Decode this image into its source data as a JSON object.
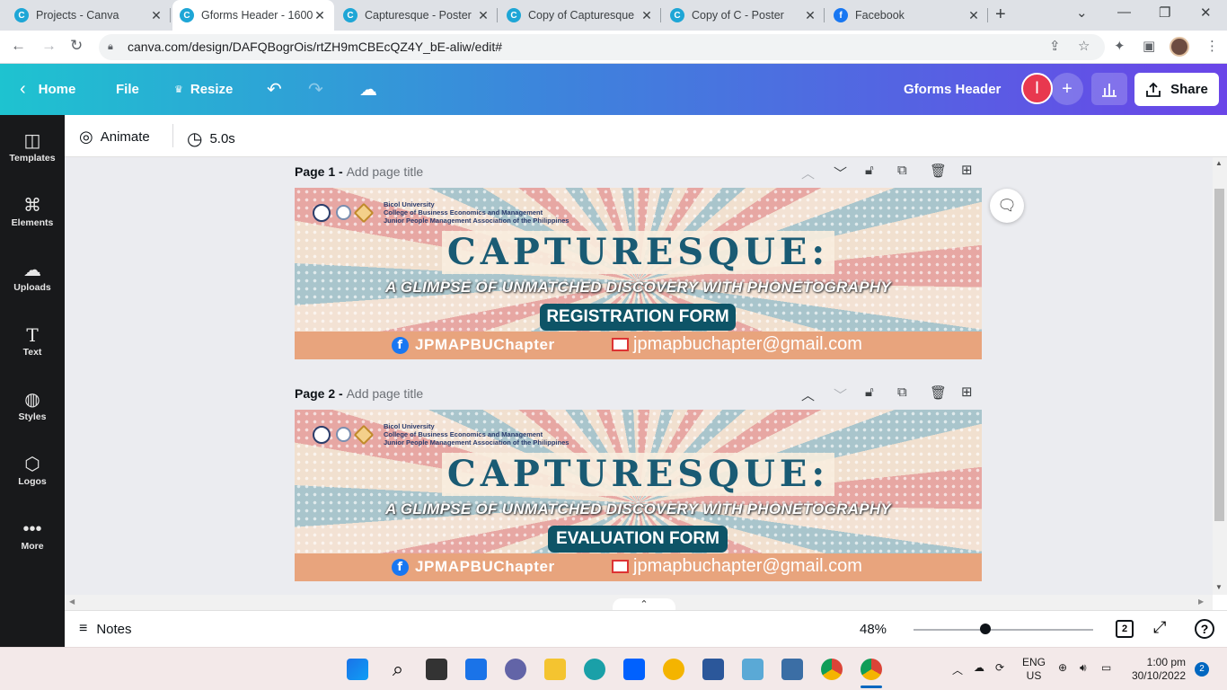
{
  "browser": {
    "tabs": [
      {
        "title": "Projects - Canva",
        "icon": "canva-icon"
      },
      {
        "title": "Gforms Header - 1600",
        "icon": "canva-icon",
        "active": true
      },
      {
        "title": "Capturesque - Poster",
        "icon": "canva-icon"
      },
      {
        "title": "Copy of Capturesque",
        "icon": "canva-icon"
      },
      {
        "title": "Copy of C - Poster",
        "icon": "canva-icon"
      },
      {
        "title": "Facebook",
        "icon": "facebook-icon"
      }
    ],
    "url": "canva.com/design/DAFQBogrOis/rtZH9mCBEcQZ4Y_bE-aliw/edit#"
  },
  "header": {
    "home": "Home",
    "file": "File",
    "resize": "Resize",
    "design_name": "Gforms Header",
    "avatar_letter": "I",
    "share": "Share"
  },
  "sidebar": {
    "items": [
      {
        "label": "Templates",
        "icon": "templates-icon"
      },
      {
        "label": "Elements",
        "icon": "elements-icon"
      },
      {
        "label": "Uploads",
        "icon": "uploads-icon"
      },
      {
        "label": "Text",
        "icon": "text-icon"
      },
      {
        "label": "Styles",
        "icon": "styles-icon"
      },
      {
        "label": "Logos",
        "icon": "logos-icon"
      },
      {
        "label": "More",
        "icon": "more-icon"
      }
    ]
  },
  "toolbar": {
    "animate": "Animate",
    "duration": "5.0s"
  },
  "pages": [
    {
      "label": "Page 1 - ",
      "title_placeholder": "Add page title",
      "banner": {
        "org_lines": [
          "Bicol University",
          "College of Business Economics and Management",
          "Junior People Management Association of the Philippines"
        ],
        "title": "CAPTURESQUE:",
        "tagline": "A GLIMPSE OF UNMATCHED DISCOVERY WITH PHONETOGRAPHY",
        "form": "REGISTRATION FORM",
        "facebook": "JPMAPBUChapter",
        "email": "jpmapbuchapter@gmail.com"
      }
    },
    {
      "label": "Page 2 - ",
      "title_placeholder": "Add page title",
      "banner": {
        "org_lines": [
          "Bicol University",
          "College of Business Economics and Management",
          "Junior People Management Association of the Philippines"
        ],
        "title": "CAPTURESQUE:",
        "tagline": "A GLIMPSE OF UNMATCHED DISCOVERY WITH PHONETOGRAPHY",
        "form": "EVALUATION FORM",
        "facebook": "JPMAPBUChapter",
        "email": "jpmapbuchapter@gmail.com"
      }
    }
  ],
  "bottom": {
    "notes": "Notes",
    "zoom": "48%",
    "zoom_fraction": 0.4,
    "page_count": "2"
  },
  "taskbar": {
    "lang_line1": "ENG",
    "lang_line2": "US",
    "time": "1:00 pm",
    "date": "30/10/2022",
    "notification_count": "2"
  },
  "colors": {
    "header_start": "#1ec3d0",
    "header_end": "#6a45e8",
    "sidebar": "#18191b",
    "form_pill": "#0e5467",
    "avatar": "#e8384f"
  }
}
